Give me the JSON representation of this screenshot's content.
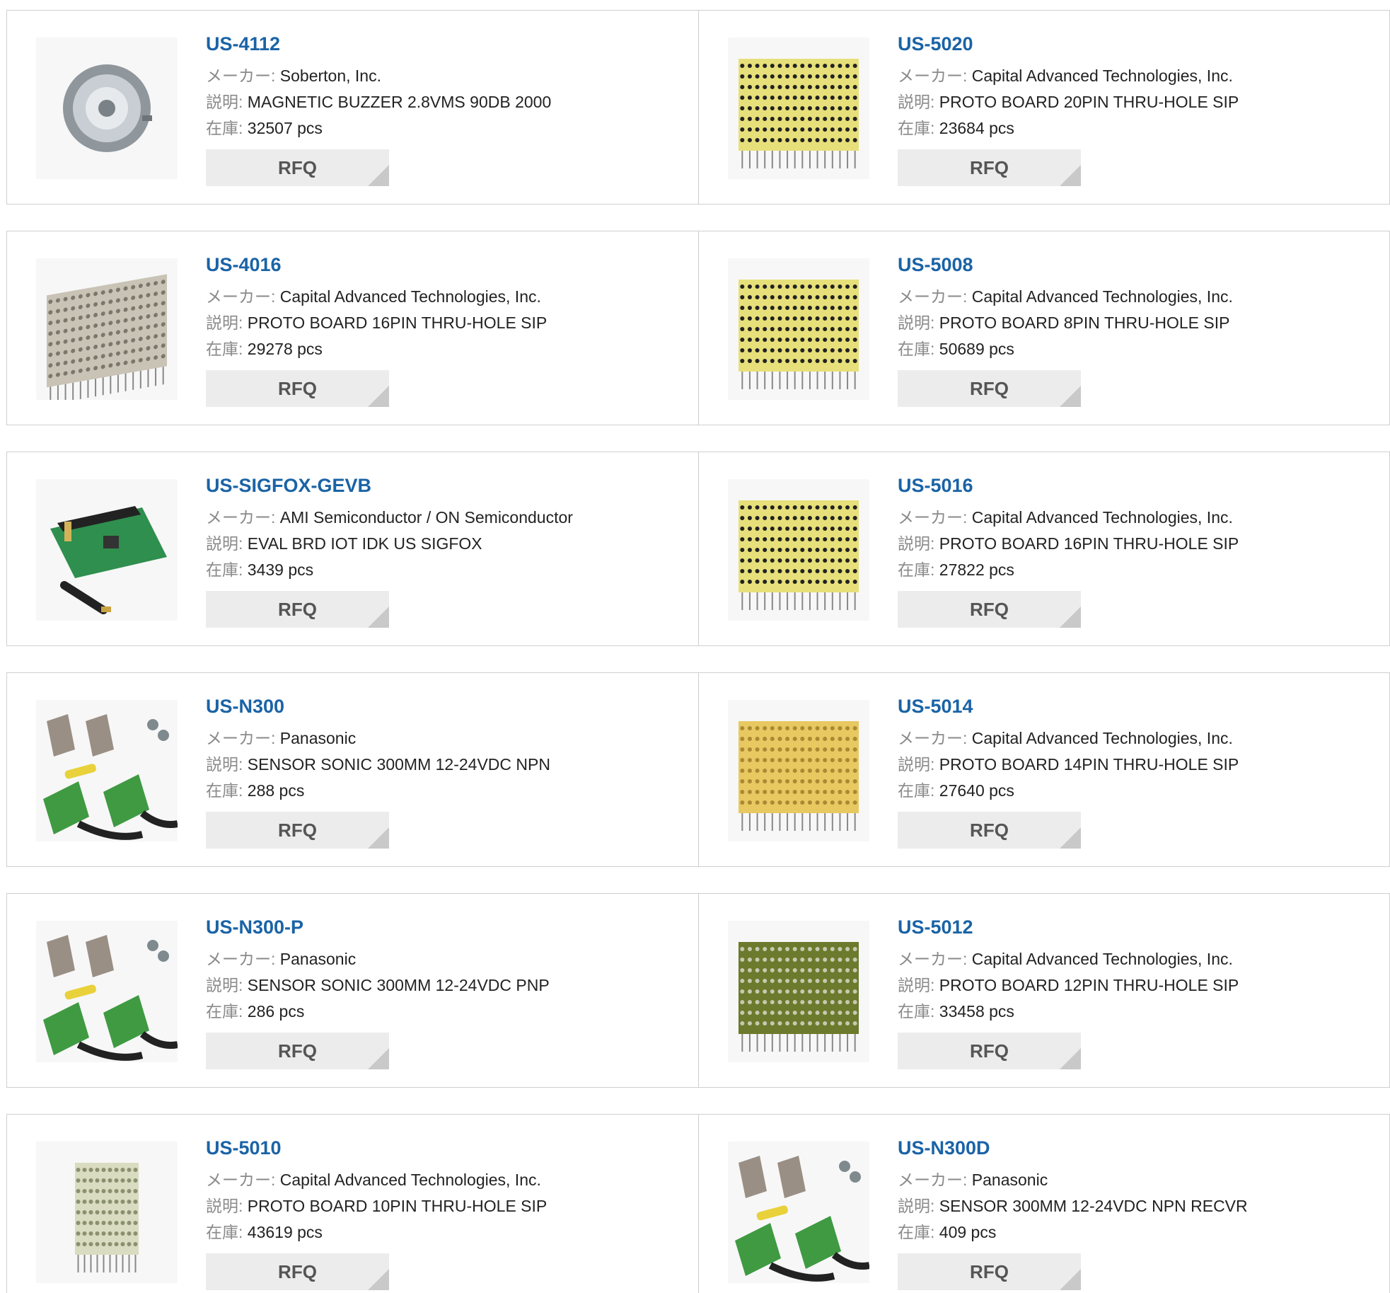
{
  "labels": {
    "manufacturer": "メーカー: ",
    "description": "説明: ",
    "stock": "在庫: ",
    "rfq": "RFQ"
  },
  "products": [
    {
      "part_number": "US-4112",
      "manufacturer": "Soberton, Inc.",
      "description": "MAGNETIC BUZZER 2.8VMS 90DB 2000",
      "stock": "32507 pcs",
      "image": "buzzer-image"
    },
    {
      "part_number": "US-5020",
      "manufacturer": "Capital Advanced Technologies, Inc.",
      "description": "PROTO BOARD 20PIN THRU-HOLE SIP",
      "stock": "23684 pcs",
      "image": "proto-board-image"
    },
    {
      "part_number": "US-4016",
      "manufacturer": "Capital Advanced Technologies, Inc.",
      "description": "PROTO BOARD 16PIN THRU-HOLE SIP",
      "stock": "29278 pcs",
      "image": "proto-board-angled-image"
    },
    {
      "part_number": "US-5008",
      "manufacturer": "Capital Advanced Technologies, Inc.",
      "description": "PROTO BOARD 8PIN THRU-HOLE SIP",
      "stock": "50689 pcs",
      "image": "proto-board-image"
    },
    {
      "part_number": "US-SIGFOX-GEVB",
      "manufacturer": "AMI Semiconductor / ON Semiconductor",
      "description": "EVAL BRD IOT IDK US SIGFOX",
      "stock": "3439 pcs",
      "image": "eval-board-image"
    },
    {
      "part_number": "US-5016",
      "manufacturer": "Capital Advanced Technologies, Inc.",
      "description": "PROTO BOARD 16PIN THRU-HOLE SIP",
      "stock": "27822 pcs",
      "image": "proto-board-image"
    },
    {
      "part_number": "US-N300",
      "manufacturer": "Panasonic",
      "description": "SENSOR SONIC 300MM 12-24VDC NPN",
      "stock": "288 pcs",
      "image": "sensor-kit-image"
    },
    {
      "part_number": "US-5014",
      "manufacturer": "Capital Advanced Technologies, Inc.",
      "description": "PROTO BOARD 14PIN THRU-HOLE SIP",
      "stock": "27640 pcs",
      "image": "proto-board-gold-image"
    },
    {
      "part_number": "US-N300-P",
      "manufacturer": "Panasonic",
      "description": "SENSOR SONIC 300MM 12-24VDC PNP",
      "stock": "286 pcs",
      "image": "sensor-kit-image"
    },
    {
      "part_number": "US-5012",
      "manufacturer": "Capital Advanced Technologies, Inc.",
      "description": "PROTO BOARD 12PIN THRU-HOLE SIP",
      "stock": "33458 pcs",
      "image": "proto-board-dark-image"
    },
    {
      "part_number": "US-5010",
      "manufacturer": "Capital Advanced Technologies, Inc.",
      "description": "PROTO BOARD 10PIN THRU-HOLE SIP",
      "stock": "43619 pcs",
      "image": "proto-board-pale-image"
    },
    {
      "part_number": "US-N300D",
      "manufacturer": "Panasonic",
      "description": "SENSOR 300MM 12-24VDC NPN RECVR",
      "stock": "409 pcs",
      "image": "sensor-kit-image"
    }
  ],
  "colors": {
    "link": "#1a63a6",
    "border": "#cfcfcf",
    "button_bg": "#ececec",
    "button_text": "#555555",
    "label_text": "#8a8a8a"
  }
}
